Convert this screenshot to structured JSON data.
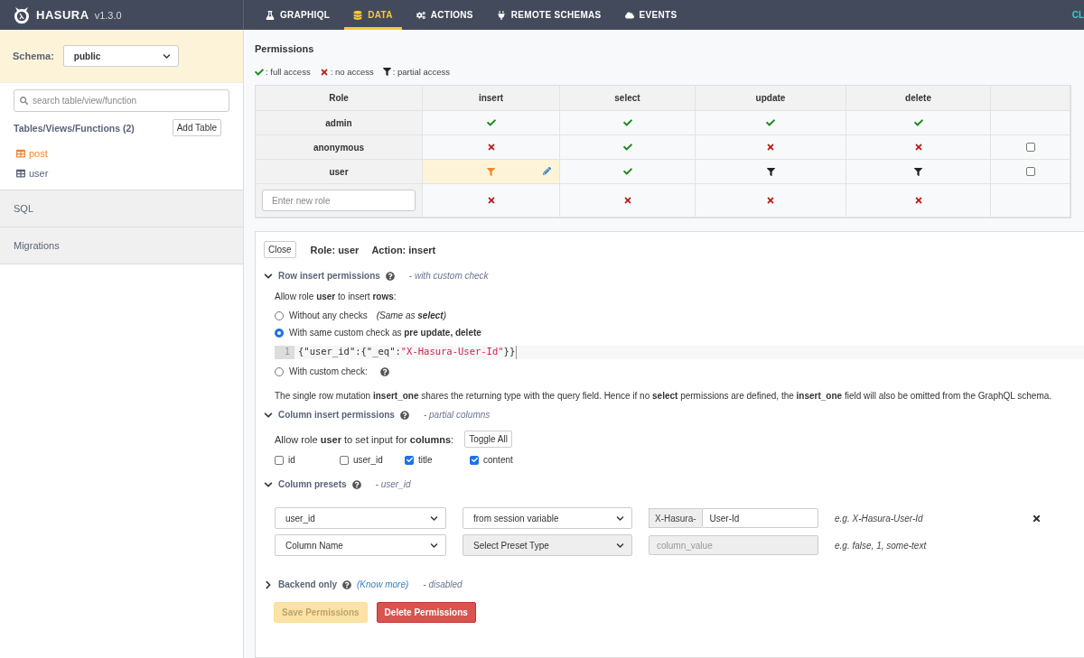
{
  "header": {
    "brand": "HASURA",
    "version": "v1.3.0",
    "nav": [
      {
        "label": "GRAPHIQL",
        "selected": false
      },
      {
        "label": "DATA",
        "selected": true
      },
      {
        "label": "ACTIONS",
        "selected": false
      },
      {
        "label": "REMOTE SCHEMAS",
        "selected": false
      },
      {
        "label": "EVENTS",
        "selected": false
      }
    ],
    "cut_text": "CL"
  },
  "sidebar": {
    "schema_label": "Schema:",
    "schema_value": "public",
    "search_placeholder": "search table/view/function",
    "tables_heading": "Tables/Views/Functions (2)",
    "add_button": "Add Table",
    "tables": [
      {
        "name": "post",
        "selected": true
      },
      {
        "name": "user",
        "selected": false
      }
    ],
    "sections": [
      "SQL",
      "Migrations"
    ]
  },
  "permissions": {
    "title": "Permissions",
    "legend": [
      {
        "kind": "full",
        "label": ": full access"
      },
      {
        "kind": "none",
        "label": ": no access"
      },
      {
        "kind": "partial",
        "label": ": partial access"
      }
    ],
    "columns": [
      "Role",
      "insert",
      "select",
      "update",
      "delete"
    ],
    "rows": [
      {
        "role": "admin",
        "cells": [
          {
            "kind": "full",
            "selected": false
          },
          {
            "kind": "full",
            "selected": false
          },
          {
            "kind": "full",
            "selected": false
          },
          {
            "kind": "full",
            "selected": false
          }
        ]
      },
      {
        "role": "anonymous",
        "checked": false,
        "cells": [
          {
            "kind": "none",
            "selected": false
          },
          {
            "kind": "full",
            "selected": false
          },
          {
            "kind": "none",
            "selected": false
          },
          {
            "kind": "none",
            "selected": false
          }
        ]
      },
      {
        "role": "user",
        "checked": false,
        "cells": [
          {
            "kind": "partial",
            "selected": true
          },
          {
            "kind": "full",
            "selected": false
          },
          {
            "kind": "partial",
            "selected": false
          },
          {
            "kind": "partial",
            "selected": false
          }
        ]
      }
    ],
    "new_role_placeholder": "Enter new role",
    "new_role_cells": [
      {
        "kind": "none",
        "selected": false
      },
      {
        "kind": "none",
        "selected": false
      },
      {
        "kind": "none",
        "selected": false
      },
      {
        "kind": "none",
        "selected": false
      }
    ]
  },
  "editor": {
    "close": "Close",
    "role_title": "Role: user",
    "action_title": "Action: insert",
    "row_section": {
      "title": "Row insert permissions",
      "expanded": true,
      "note": "- with custom check"
    },
    "allow_text": "Allow role **user** to insert **rows**:",
    "checks": [
      {
        "label": "Without any checks",
        "note": "(Same as **select**)",
        "selected": false
      },
      {
        "label": "With same custom check as **pre update, delete**",
        "selected": true,
        "line_number": "1",
        "code": [
          {
            "kind": "plain",
            "text": "{\"user_id\":{\"_eq\":"
          },
          {
            "kind": "string",
            "text": "\"X-Hasura-User-Id\""
          },
          {
            "kind": "plain",
            "text": "}}"
          }
        ]
      },
      {
        "label": "With custom check:",
        "help": true,
        "selected": false
      }
    ],
    "info": "The single row mutation **insert_one** shares the returning type with the query field. Hence if no **select** permissions are defined, the **insert_one** field will also be omitted from the GraphQL schema.",
    "column_section": {
      "title": "Column insert permissions",
      "expanded": true,
      "note": "- partial columns"
    },
    "columns_text": "Allow role **user** to set input for **columns**:",
    "toggle_all": "Toggle All",
    "columns": [
      {
        "name": "id",
        "checked": false
      },
      {
        "name": "user_id",
        "checked": false
      },
      {
        "name": "title",
        "checked": true
      },
      {
        "name": "content",
        "checked": true
      }
    ],
    "presets_section": {
      "title": "Column presets",
      "expanded": true,
      "note": "- user_id"
    },
    "presets": [
      {
        "column": "user_id",
        "type": "from session variable",
        "type_disabled": false,
        "prefix": "X-Hasura-",
        "value": "User-Id",
        "example": "e.g. X-Hasura-User-Id",
        "removable": true
      },
      {
        "column": "Column Name",
        "type": "Select Preset Type",
        "type_disabled": true,
        "placeholder": "column_value",
        "example": "e.g. false, 1, some-text",
        "removable": false
      }
    ],
    "backend_section": {
      "title": "Backend only",
      "expanded": false,
      "link": "(Know more)",
      "note": "- disabled"
    },
    "save_button": {
      "label": "Save Permissions",
      "disabled": true
    },
    "delete_button": {
      "label": "Delete Permissions"
    }
  }
}
